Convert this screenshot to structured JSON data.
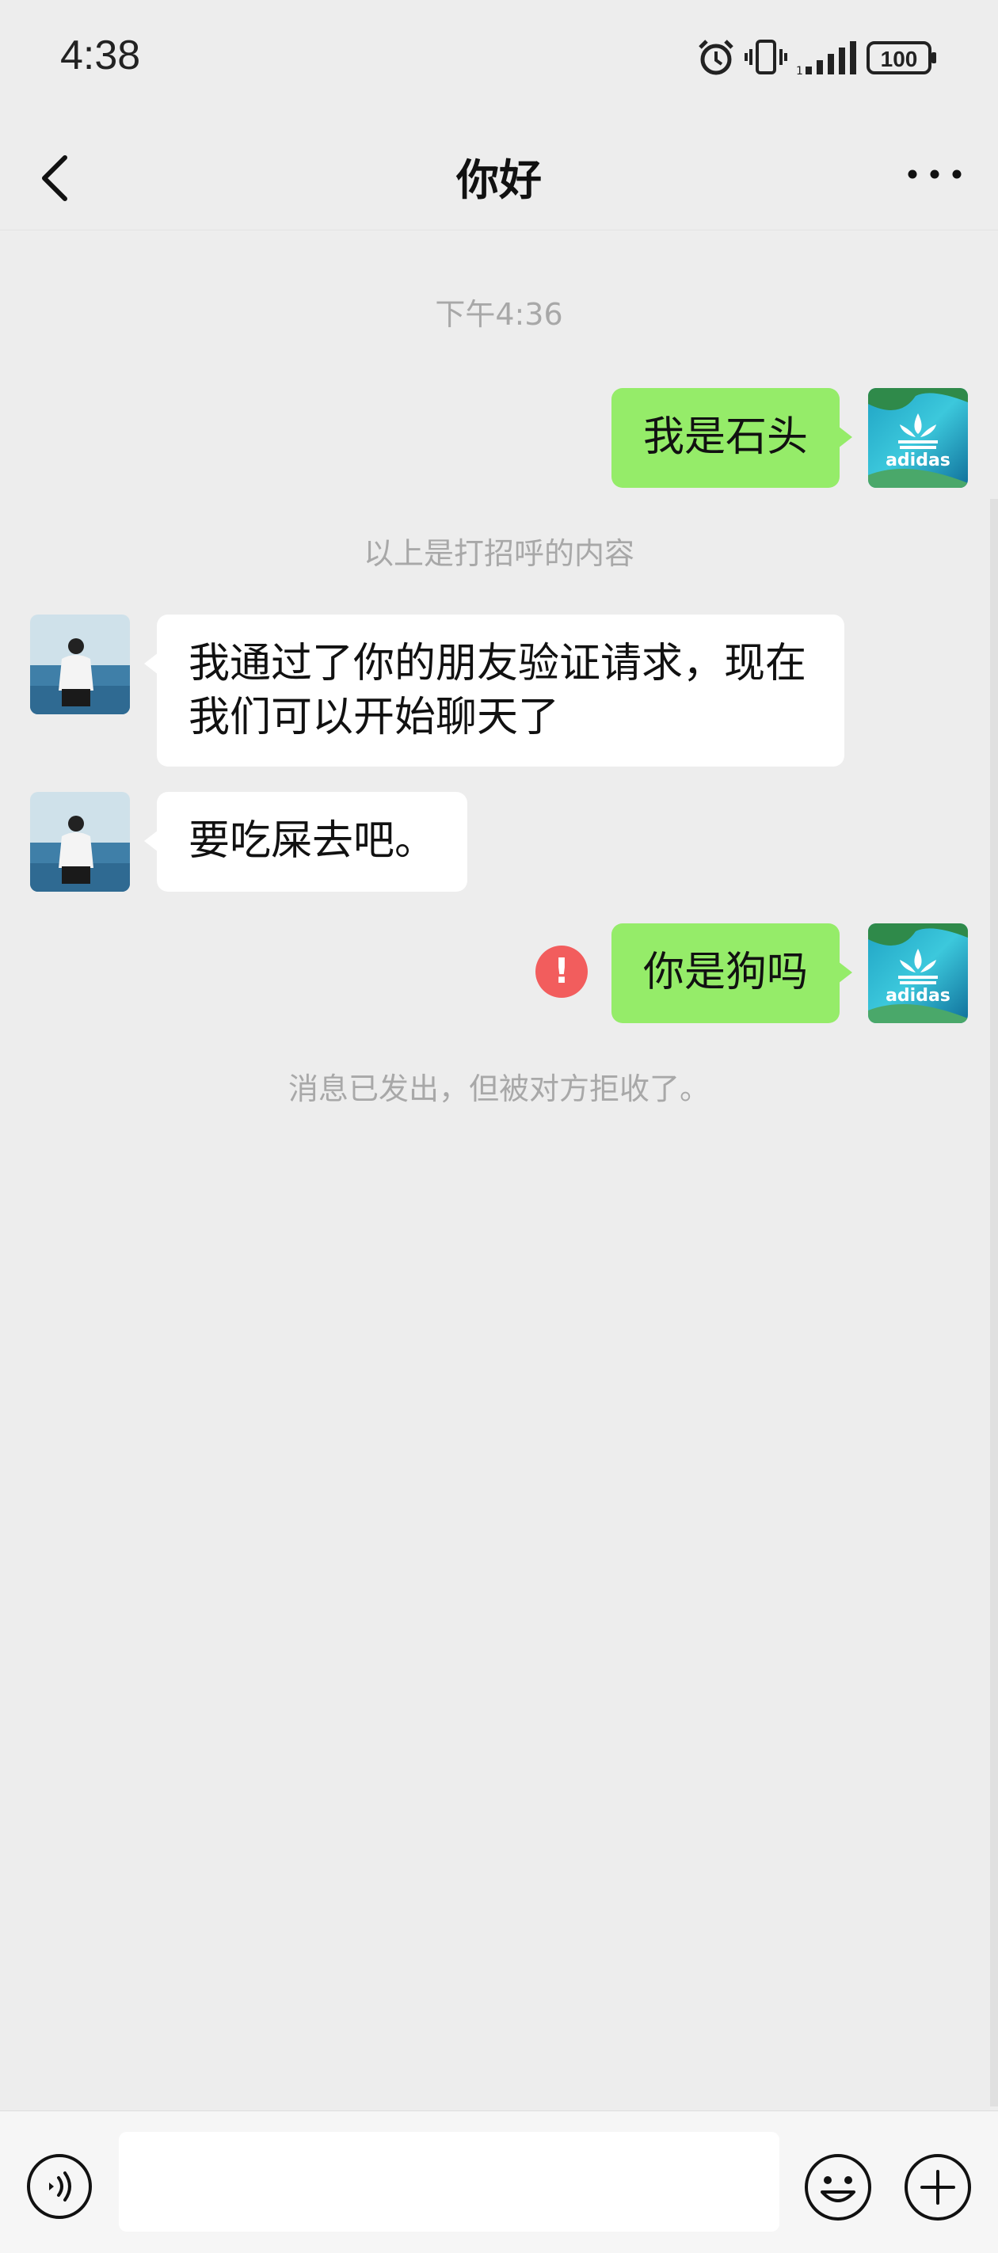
{
  "status_bar": {
    "time": "4:38",
    "battery": "100",
    "icons": [
      "alarm-icon",
      "vibrate-icon",
      "signal-icon",
      "battery-icon"
    ]
  },
  "header": {
    "title": "你好",
    "back_icon": "chevron-left-icon",
    "more_icon": "more-dots-icon"
  },
  "chat": {
    "timestamp": "下午4:36",
    "greeting_note": "以上是打招呼的内容",
    "rejected_note": "消息已发出，但被对方拒收了。",
    "messages": [
      {
        "direction": "out",
        "text": "我是石头",
        "avatar": "adidas-avatar"
      },
      {
        "direction": "in",
        "text": "我通过了你的朋友验证请求，现在我们可以开始聊天了",
        "avatar": "person-avatar"
      },
      {
        "direction": "in",
        "text": "要吃屎去吧。",
        "avatar": "person-avatar"
      },
      {
        "direction": "out",
        "text": "你是狗吗",
        "avatar": "adidas-avatar",
        "status": "failed"
      }
    ]
  },
  "input_bar": {
    "placeholder": "",
    "icons": [
      "voice-icon",
      "emoji-icon",
      "plus-icon"
    ]
  },
  "colors": {
    "background": "#ededed",
    "outgoing_bubble": "#95ec69",
    "incoming_bubble": "#ffffff",
    "error": "#f25d5d",
    "system_text": "#a8a8a8"
  }
}
